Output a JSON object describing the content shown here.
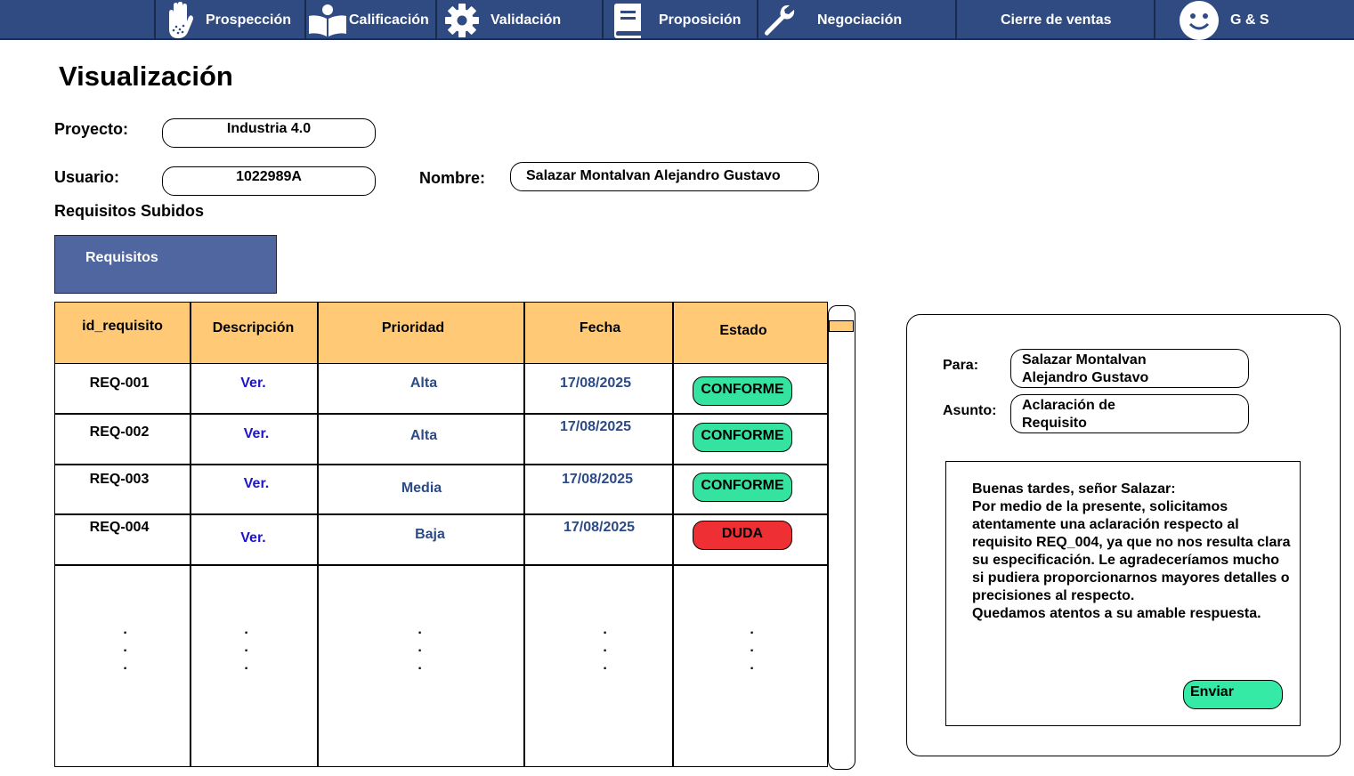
{
  "nav": {
    "items": [
      {
        "label": "Prospección",
        "icon": "hand-icon"
      },
      {
        "label": "Calificación",
        "icon": "open-book-icon"
      },
      {
        "label": "Validación",
        "icon": "gear-icon"
      },
      {
        "label": "Proposición",
        "icon": "book-icon"
      },
      {
        "label": "Negociación",
        "icon": "wrench-icon"
      },
      {
        "label": "Cierre de ventas",
        "icon": ""
      }
    ],
    "brand": {
      "label": "G & S",
      "icon": "smiley-icon"
    }
  },
  "page": {
    "title": "Visualización"
  },
  "form": {
    "project_label": "Proyecto:",
    "project_value": "Industria 4.0",
    "user_label": "Usuario:",
    "user_value": "1022989A",
    "name_label": "Nombre:",
    "name_value": "Salazar Montalvan Alejandro Gustavo"
  },
  "section": {
    "heading": "Requisitos Subidos",
    "tab_label": "Requisitos"
  },
  "table": {
    "headers": [
      "id_requisito",
      "Descripción",
      "Prioridad",
      "Fecha",
      "Estado"
    ],
    "rows": [
      {
        "id": "REQ-001",
        "desc": "Ver.",
        "priority": "Alta",
        "date": "17/08/2025",
        "status": "CONFORME"
      },
      {
        "id": "REQ-002",
        "desc": "Ver.",
        "priority": "Alta",
        "date": "17/08/2025",
        "status": "CONFORME"
      },
      {
        "id": "REQ-003",
        "desc": "Ver.",
        "priority": "Media",
        "date": "17/08/2025",
        "status": "CONFORME"
      },
      {
        "id": "REQ-004",
        "desc": "Ver.",
        "priority": "Baja",
        "date": "17/08/2025",
        "status": "DUDA"
      }
    ],
    "ellipsis": "·\n·\n·"
  },
  "message": {
    "to_label": "Para:",
    "to_value": "Salazar Montalvan\nAlejandro Gustavo",
    "subject_label": "Asunto:",
    "subject_value": "Aclaración de\nRequisito",
    "body": "Buenas tardes, señor Salazar:\nPor medio de la presente, solicitamos atentamente una aclaración respecto al requisito REQ_004, ya que no nos resulta clara su especificación. Le agradeceríamos mucho si pudiera proporcionarnos mayores detalles o precisiones al respecto.\nQuedamos atentos a su amable respuesta.",
    "send_label": "Enviar"
  },
  "colors": {
    "nav": "#2f4b82",
    "tab": "#4f66a0",
    "table_header": "#ffc976",
    "status_ok": "#34e3a0",
    "status_doubt": "#ee2f34",
    "link": "#1e14c8",
    "muted_blue": "#2c4a86"
  }
}
